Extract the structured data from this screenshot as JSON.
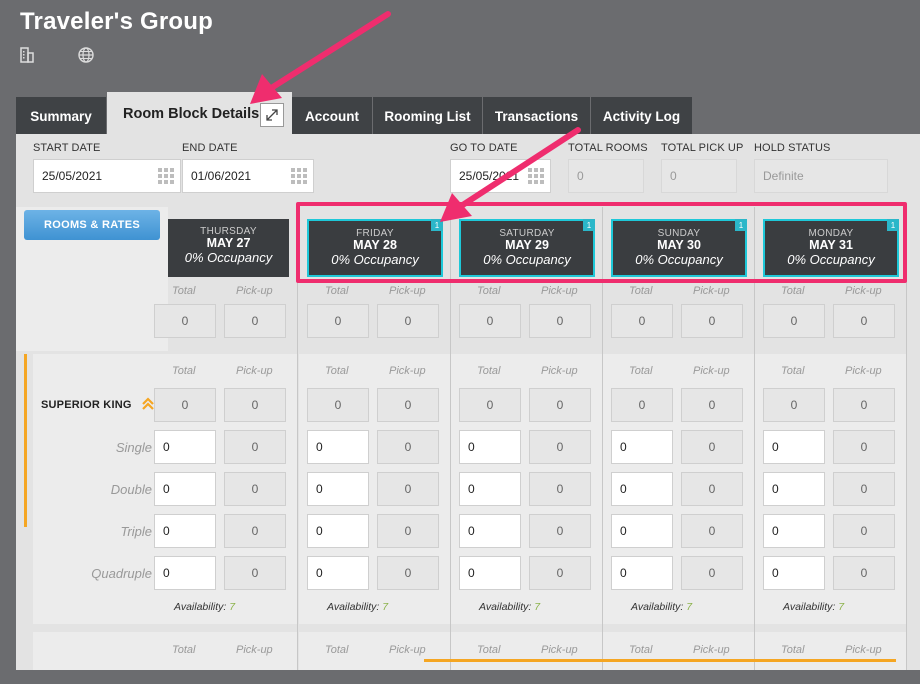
{
  "header": {
    "title": "Traveler's Group",
    "icons": [
      "building-icon",
      "globe-icon"
    ]
  },
  "tabs": [
    {
      "label": "Summary",
      "active": false
    },
    {
      "label": "Room Block Details",
      "active": true
    },
    {
      "label": "Account",
      "active": false
    },
    {
      "label": "Rooming List",
      "active": false
    },
    {
      "label": "Transactions",
      "active": false
    },
    {
      "label": "Activity Log",
      "active": false
    }
  ],
  "filters": {
    "start_date": {
      "label": "START DATE",
      "value": "25/05/2021"
    },
    "end_date": {
      "label": "END DATE",
      "value": "01/06/2021"
    },
    "go_to_date": {
      "label": "GO TO DATE",
      "value": "25/05/2021"
    },
    "total_rooms": {
      "label": "TOTAL ROOMS",
      "value": "0"
    },
    "total_pickup": {
      "label": "TOTAL PICK UP",
      "value": "0"
    },
    "hold_status": {
      "label": "HOLD STATUS",
      "value": "Definite"
    }
  },
  "rooms_rates_button": "ROOMS & RATES",
  "subheaders": {
    "total": "Total",
    "pickup": "Pick-up"
  },
  "days": [
    {
      "dow": "THURSDAY",
      "date": "MAY 27",
      "occupancy": "0% Occupancy",
      "badge": "",
      "total": "0",
      "pickup": "0",
      "room_total": "0",
      "room_pickup": "0",
      "rows": [
        [
          "0",
          "0"
        ],
        [
          "0",
          "0"
        ],
        [
          "0",
          "0"
        ],
        [
          "0",
          "0"
        ]
      ],
      "availability": "7"
    },
    {
      "dow": "FRIDAY",
      "date": "MAY 28",
      "occupancy": "0% Occupancy",
      "badge": "1",
      "total": "0",
      "pickup": "0",
      "room_total": "0",
      "room_pickup": "0",
      "rows": [
        [
          "0",
          "0"
        ],
        [
          "0",
          "0"
        ],
        [
          "0",
          "0"
        ],
        [
          "0",
          "0"
        ]
      ],
      "availability": "7"
    },
    {
      "dow": "SATURDAY",
      "date": "MAY 29",
      "occupancy": "0% Occupancy",
      "badge": "1",
      "total": "0",
      "pickup": "0",
      "room_total": "0",
      "room_pickup": "0",
      "rows": [
        [
          "0",
          "0"
        ],
        [
          "0",
          "0"
        ],
        [
          "0",
          "0"
        ],
        [
          "0",
          "0"
        ]
      ],
      "availability": "7"
    },
    {
      "dow": "SUNDAY",
      "date": "MAY 30",
      "occupancy": "0% Occupancy",
      "badge": "1",
      "total": "0",
      "pickup": "0",
      "room_total": "0",
      "room_pickup": "0",
      "rows": [
        [
          "0",
          "0"
        ],
        [
          "0",
          "0"
        ],
        [
          "0",
          "0"
        ],
        [
          "0",
          "0"
        ]
      ],
      "availability": "7"
    },
    {
      "dow": "MONDAY",
      "date": "MAY 31",
      "occupancy": "0% Occupancy",
      "badge": "1",
      "total": "0",
      "pickup": "0",
      "room_total": "0",
      "room_pickup": "0",
      "rows": [
        [
          "0",
          "0"
        ],
        [
          "0",
          "0"
        ],
        [
          "0",
          "0"
        ],
        [
          "0",
          "0"
        ]
      ],
      "availability": "7"
    }
  ],
  "room_type": {
    "name": "SUPERIOR KING",
    "rows": [
      "Single",
      "Double",
      "Triple",
      "Quadruple"
    ]
  },
  "availability_label": "Availability:",
  "colors": {
    "accent": "#f5a623",
    "highlight": "#ef2d6e",
    "badge": "#2bb7c9",
    "availability": "#8bb24a"
  }
}
